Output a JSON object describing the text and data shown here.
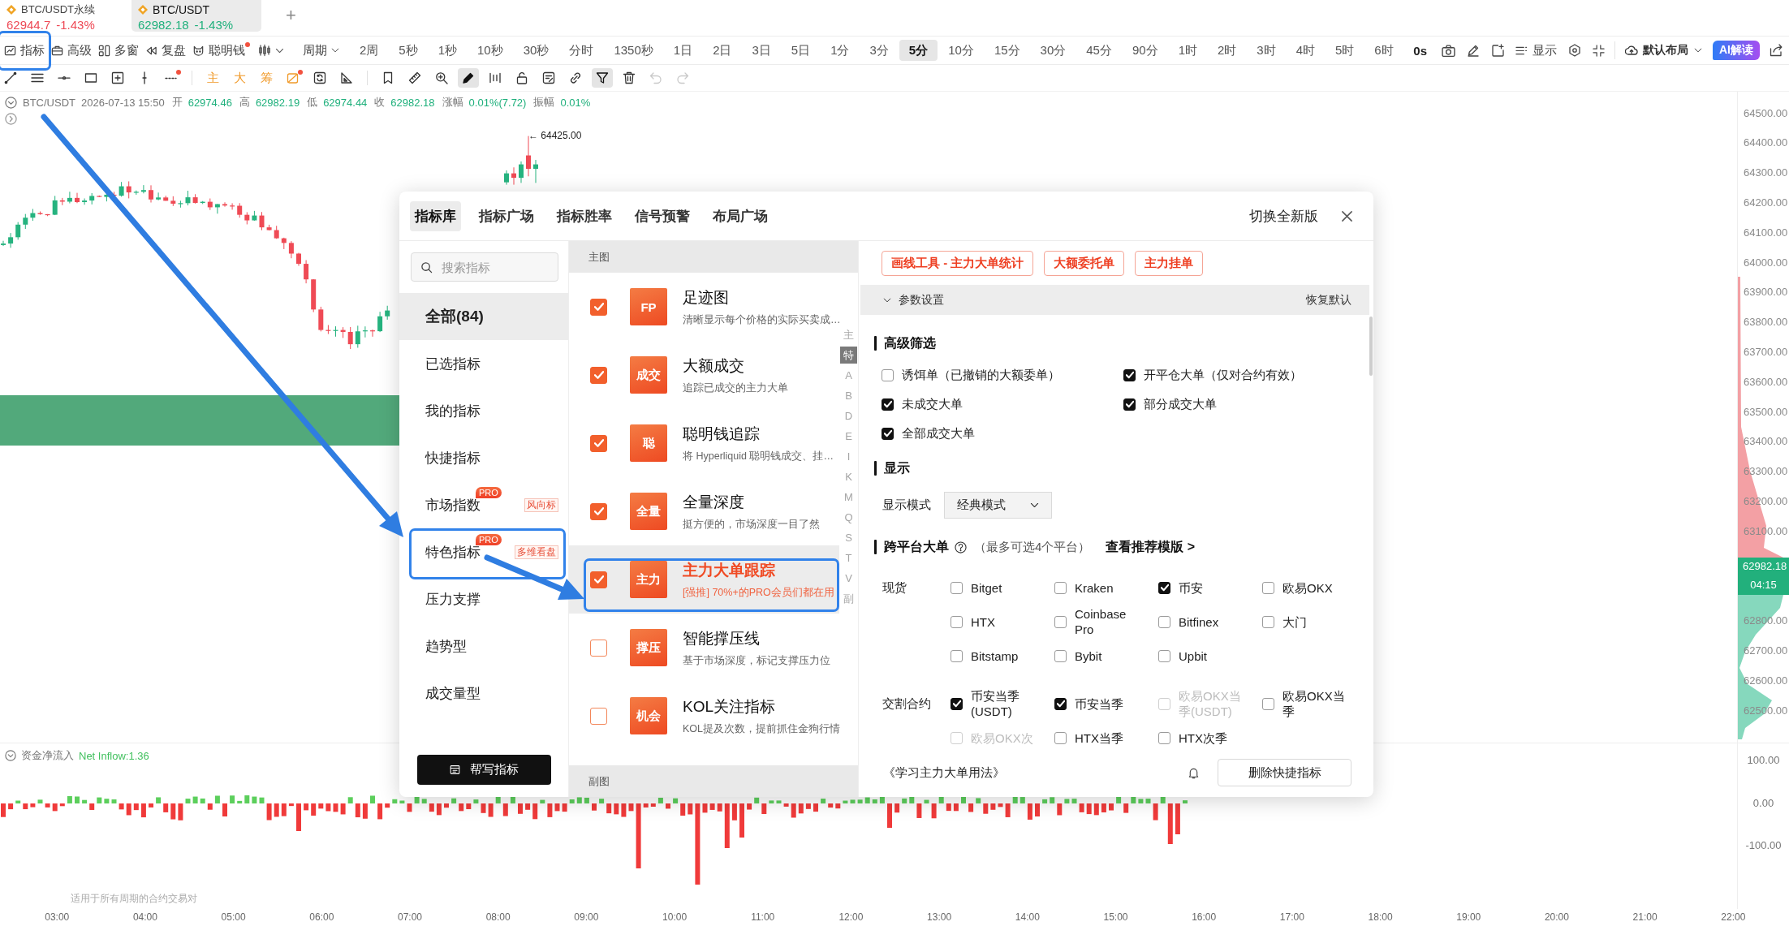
{
  "symbol_tabs": [
    {
      "name": "BTC/USDT永续",
      "price": "62944.7",
      "change": "-1.43%",
      "color": "#ee4a56",
      "selected": false
    },
    {
      "name": "BTC/USDT",
      "price": "62982.18",
      "change": "-1.43%",
      "color": "#1fb07c",
      "selected": true
    }
  ],
  "new_tab": "+",
  "toolbar": {
    "tools": [
      {
        "label": "指标",
        "dot": false,
        "annotated": true
      },
      {
        "label": "高级",
        "dot": false,
        "annotated": false
      },
      {
        "label": "多窗",
        "dot": false,
        "annotated": false
      },
      {
        "label": "复盘",
        "dot": false,
        "annotated": false
      },
      {
        "label": "聪明钱",
        "dot": true,
        "annotated": false
      }
    ],
    "period_menu": "周期",
    "intervals": [
      {
        "label": "2周",
        "selected": false
      },
      {
        "label": "5秒",
        "selected": false
      },
      {
        "label": "1秒",
        "selected": false
      },
      {
        "label": "10秒",
        "selected": false
      },
      {
        "label": "30秒",
        "selected": false
      },
      {
        "label": "分时",
        "selected": false
      },
      {
        "label": "1350秒",
        "selected": false
      },
      {
        "label": "1日",
        "selected": false
      },
      {
        "label": "2日",
        "selected": false
      },
      {
        "label": "3日",
        "selected": false
      },
      {
        "label": "5日",
        "selected": false
      },
      {
        "label": "1分",
        "selected": false
      },
      {
        "label": "3分",
        "selected": false
      },
      {
        "label": "5分",
        "selected": true
      },
      {
        "label": "10分",
        "selected": false
      },
      {
        "label": "15分",
        "selected": false
      },
      {
        "label": "30分",
        "selected": false
      },
      {
        "label": "45分",
        "selected": false
      },
      {
        "label": "90分",
        "selected": false
      },
      {
        "label": "1时",
        "selected": false
      },
      {
        "label": "2时",
        "selected": false
      },
      {
        "label": "3时",
        "selected": false
      },
      {
        "label": "4时",
        "selected": false
      },
      {
        "label": "5时",
        "selected": false
      },
      {
        "label": "6时",
        "selected": false
      }
    ],
    "timer": "0s",
    "display_menu": "显示",
    "layout_menu": "默认布局",
    "ai_button": "AI解读"
  },
  "draw_tools": [
    {
      "items": [
        {
          "kind": "icon",
          "selected": false,
          "disabled": false,
          "dot": false
        },
        {
          "kind": "icon",
          "selected": false,
          "disabled": false,
          "dot": false
        },
        {
          "kind": "icon",
          "selected": false,
          "disabled": false,
          "dot": false
        },
        {
          "kind": "icon",
          "selected": false,
          "disabled": false,
          "dot": false
        },
        {
          "kind": "icon",
          "selected": false,
          "disabled": false,
          "dot": false
        },
        {
          "kind": "icon",
          "selected": false,
          "disabled": false,
          "dot": false
        },
        {
          "kind": "icon",
          "selected": false,
          "disabled": false,
          "dot": true
        }
      ]
    },
    {
      "items": [
        {
          "kind": "char",
          "label": "主",
          "selected": false,
          "disabled": false,
          "dot": false
        },
        {
          "kind": "char",
          "label": "大",
          "selected": false,
          "disabled": false,
          "dot": false
        },
        {
          "kind": "char",
          "label": "筹",
          "selected": false,
          "disabled": false,
          "dot": false
        },
        {
          "kind": "icon",
          "selected": false,
          "disabled": false,
          "dot": true
        },
        {
          "kind": "icon",
          "selected": false,
          "disabled": false,
          "dot": false
        },
        {
          "kind": "icon",
          "selected": false,
          "disabled": false,
          "dot": false
        }
      ]
    },
    {
      "items": [
        {
          "kind": "icon",
          "selected": false,
          "disabled": false,
          "dot": false
        },
        {
          "kind": "icon",
          "selected": false,
          "disabled": false,
          "dot": false
        },
        {
          "kind": "icon",
          "selected": false,
          "disabled": false,
          "dot": false
        },
        {
          "kind": "icon",
          "selected": true,
          "disabled": false,
          "dot": false
        },
        {
          "kind": "icon",
          "selected": false,
          "disabled": false,
          "dot": false
        },
        {
          "kind": "icon",
          "selected": false,
          "disabled": false,
          "dot": false
        },
        {
          "kind": "icon",
          "selected": false,
          "disabled": false,
          "dot": false
        },
        {
          "kind": "icon",
          "selected": false,
          "disabled": false,
          "dot": false
        },
        {
          "kind": "icon",
          "selected": true,
          "disabled": false,
          "dot": false
        },
        {
          "kind": "icon",
          "selected": false,
          "disabled": false,
          "dot": false
        },
        {
          "kind": "icon",
          "selected": false,
          "disabled": true,
          "dot": false
        },
        {
          "kind": "icon",
          "selected": false,
          "disabled": true,
          "dot": false
        }
      ]
    }
  ],
  "chart": {
    "header": {
      "symbol": "BTC/USDT",
      "time": "2026-07-13 15:50",
      "fields": [
        {
          "label": "开",
          "value": "62974.46"
        },
        {
          "label": "高",
          "value": "62982.19"
        },
        {
          "label": "低",
          "value": "62974.44"
        },
        {
          "label": "收",
          "value": "62982.18"
        },
        {
          "label": "涨幅",
          "value": "0.01%(7.72)"
        },
        {
          "label": "振幅",
          "value": "0.01%"
        }
      ]
    },
    "high_marker": "← 64425.00",
    "price_axis_upper": [
      "64500.00",
      "64400.00",
      "64300.00",
      "64200.00",
      "64100.00",
      "64000.00",
      "63900.00",
      "63800.00",
      "63700.00",
      "63600.00",
      "63500.00",
      "63400.00",
      "63300.00",
      "63200.00",
      "63100.00"
    ],
    "last_price": "62982.18",
    "countdown": "04:15",
    "price_axis_lower": [
      "62800.00",
      "62700.00",
      "62600.00",
      "62500.00"
    ],
    "indicator_pane": {
      "title": "资金净流入",
      "reading": "Net Inflow:1.36",
      "axis": [
        "100.00",
        "0.00",
        "-100.00"
      ]
    },
    "note": "适用于所有周期的合约交易对",
    "time_axis": [
      "03:00",
      "04:00",
      "05:00",
      "06:00",
      "07:00",
      "08:00",
      "09:00",
      "10:00",
      "11:00",
      "12:00",
      "13:00",
      "14:00",
      "15:00",
      "16:00",
      "17:00",
      "18:00",
      "19:00",
      "20:00",
      "21:00",
      "22:00"
    ]
  },
  "dialog": {
    "tabs": [
      {
        "label": "指标库",
        "selected": true
      },
      {
        "label": "指标广场",
        "selected": false
      },
      {
        "label": "指标胜率",
        "selected": false
      },
      {
        "label": "信号预警",
        "selected": false
      },
      {
        "label": "布局广场",
        "selected": false
      }
    ],
    "switch_version": "切换全新版",
    "search": {
      "placeholder": "搜索指标"
    },
    "categories": [
      {
        "label": "全部(84)",
        "selected": true,
        "annotated": false
      },
      {
        "label": "已选指标",
        "selected": false,
        "annotated": false
      },
      {
        "label": "我的指标",
        "selected": false,
        "annotated": false
      },
      {
        "label": "快捷指标",
        "selected": false,
        "annotated": false
      },
      {
        "label": "市场指数",
        "badge": "PRO",
        "tag": "风向标",
        "selected": false,
        "annotated": false
      },
      {
        "label": "特色指标",
        "badge": "PRO",
        "tag": "多维看盘",
        "selected": false,
        "annotated": true
      },
      {
        "label": "压力支撑",
        "selected": false,
        "annotated": false
      },
      {
        "label": "趋势型",
        "selected": false,
        "annotated": false
      },
      {
        "label": "成交量型",
        "selected": false,
        "annotated": false
      }
    ],
    "help_button": "帮写指标",
    "main_section": "主图",
    "indicators": [
      {
        "logo": "FP",
        "name": "足迹图",
        "description": "清晰显示每个价格的实际买卖成…",
        "checked": true,
        "selected": false,
        "annotated": false
      },
      {
        "logo": "成交",
        "name": "大额成交",
        "description": "追踪已成交的主力大单",
        "checked": true,
        "selected": false,
        "annotated": false
      },
      {
        "logo": "聪",
        "name": "聪明钱追踪",
        "description": "将 Hyperliquid 聪明钱成交、挂…",
        "checked": true,
        "selected": false,
        "annotated": false
      },
      {
        "logo": "全量",
        "name": "全量深度",
        "description": "挺方便的，市场深度一目了然",
        "checked": true,
        "selected": false,
        "annotated": false
      },
      {
        "logo": "主力",
        "name": "主力大单跟踪",
        "description": "[强推] 70%+的PRO会员们都在用",
        "checked": true,
        "selected": true,
        "annotated": true
      },
      {
        "logo": "撑压",
        "name": "智能撑压线",
        "description": "基于市场深度，标记支撑压力位",
        "checked": false,
        "selected": false,
        "annotated": false
      },
      {
        "logo": "机会",
        "name": "KOL关注指标",
        "description": "KOL提及次数，提前抓住金狗行情",
        "checked": false,
        "selected": false,
        "annotated": false
      }
    ],
    "sub_section": "副图",
    "index_letters": [
      {
        "label": "主",
        "selected": false
      },
      {
        "label": "特",
        "selected": true
      },
      {
        "label": "A",
        "selected": false
      },
      {
        "label": "B",
        "selected": false
      },
      {
        "label": "D",
        "selected": false
      },
      {
        "label": "E",
        "selected": false
      },
      {
        "label": "I",
        "selected": false
      },
      {
        "label": "K",
        "selected": false
      },
      {
        "label": "M",
        "selected": false
      },
      {
        "label": "Q",
        "selected": false
      },
      {
        "label": "S",
        "selected": false
      },
      {
        "label": "T",
        "selected": false
      },
      {
        "label": "V",
        "selected": false
      },
      {
        "label": "副",
        "selected": false
      }
    ],
    "detail": {
      "links": [
        "画线工具 - 主力大单统计",
        "大额委托单",
        "主力挂单"
      ],
      "settings": {
        "title": "参数设置",
        "reset": "恢复默认",
        "expanded": true
      },
      "filter_title": "高级筛选",
      "filters": [
        {
          "label": "诱饵单（已撤销的大额委单）",
          "checked": false
        },
        {
          "label": "开平仓大单（仅对合约有效）",
          "checked": true
        },
        {
          "label": "未成交大单",
          "checked": true
        },
        {
          "label": "部分成交大单",
          "checked": true
        },
        {
          "label": "全部成交大单",
          "checked": true
        }
      ],
      "display_title": "显示",
      "display_mode": {
        "label": "显示模式",
        "value": "经典模式"
      },
      "cross_title": "跨平台大单",
      "cross_note": "（最多可选4个平台）",
      "template_link": "查看推荐模版 >",
      "exchange_groups": [
        {
          "label": "现货",
          "options": [
            {
              "label": "Bitget",
              "checked": false,
              "disabled": false
            },
            {
              "label": "Kraken",
              "checked": false,
              "disabled": false
            },
            {
              "label": "币安",
              "checked": true,
              "disabled": false
            },
            {
              "label": "欧易OKX",
              "checked": false,
              "disabled": false
            },
            {
              "label": "HTX",
              "checked": false,
              "disabled": false
            },
            {
              "label": "Coinbase Pro",
              "checked": false,
              "disabled": false
            },
            {
              "label": "Bitfinex",
              "checked": false,
              "disabled": false
            },
            {
              "label": "大门",
              "checked": false,
              "disabled": false
            },
            {
              "label": "Bitstamp",
              "checked": false,
              "disabled": false
            },
            {
              "label": "Bybit",
              "checked": false,
              "disabled": false
            },
            {
              "label": "Upbit",
              "checked": false,
              "disabled": false
            }
          ]
        },
        {
          "label": "交割合约",
          "options": [
            {
              "label": "币安当季 (USDT)",
              "checked": true,
              "disabled": false
            },
            {
              "label": "币安当季",
              "checked": true,
              "disabled": false
            },
            {
              "label": "欧易OKX当季(USDT)",
              "checked": false,
              "disabled": true
            },
            {
              "label": "欧易OKX当季",
              "checked": false,
              "disabled": false
            },
            {
              "label": "欧易OKX次",
              "checked": false,
              "disabled": true
            },
            {
              "label": "HTX当季",
              "checked": false,
              "disabled": false
            },
            {
              "label": "HTX次季",
              "checked": false,
              "disabled": false
            }
          ]
        }
      ],
      "learn_link": "《学习主力大单用法》",
      "remove_button": "删除快捷指标"
    }
  }
}
